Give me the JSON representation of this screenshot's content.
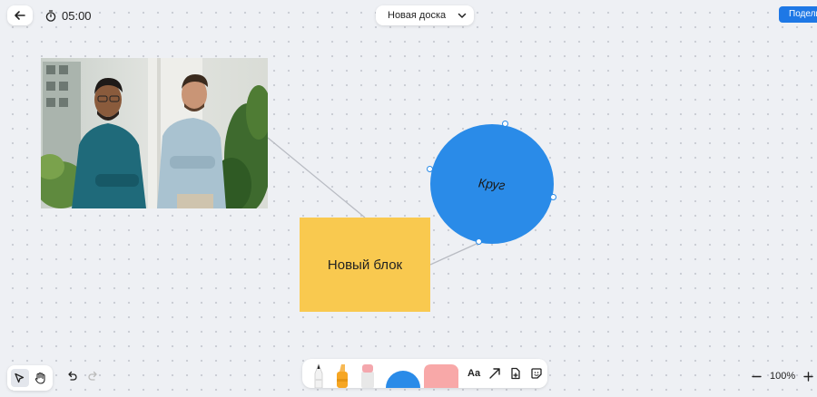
{
  "header": {
    "timer": "05:00",
    "board_name": "Новая доска",
    "share_label": "Поделиться"
  },
  "canvas": {
    "sticky_text": "Новый блок",
    "circle_text": "Круг",
    "photo_description_icon": "photo-two-men"
  },
  "toolbar": {
    "text_tool_label": "Aa"
  },
  "zoom": {
    "level": "100%"
  },
  "colors": {
    "sticky": "#f9c94f",
    "circle": "#2a8be8",
    "share_button": "#1e78e6",
    "shape_tool_pink": "#f8a8a8"
  }
}
